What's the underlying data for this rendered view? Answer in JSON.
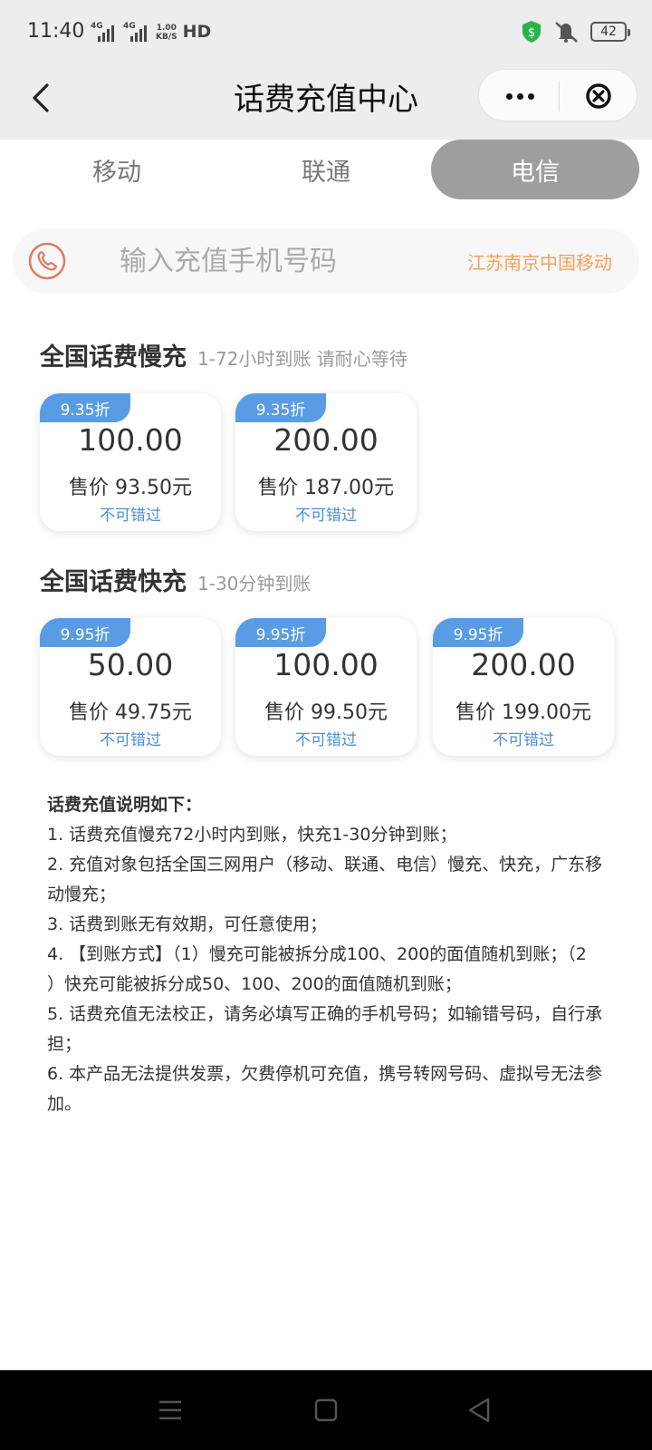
{
  "status_bar": {
    "time": "11:40",
    "signal1_label": "4G",
    "signal2_label": "4G",
    "speed_value": "1.00",
    "speed_unit": "KB/S",
    "hd_label": "HD",
    "battery": "42",
    "icons": [
      "shield-dollar-icon",
      "bell-muted-icon",
      "battery-icon"
    ]
  },
  "nav": {
    "title": "话费充值中心",
    "icons": [
      "back-arrow-icon",
      "more-dots-icon",
      "close-circle-icon"
    ]
  },
  "carrier_tabs": [
    {
      "label": "移动",
      "selected": false
    },
    {
      "label": "联通",
      "selected": false
    },
    {
      "label": "电信",
      "selected": true
    }
  ],
  "phone": {
    "placeholder": "输入充值手机号码",
    "location": "江苏南京中国移动",
    "icon": "phone-icon"
  },
  "slow": {
    "title": "全国话费慢充",
    "subtitle": "1-72小时到账 请耐心等待",
    "cards": [
      {
        "discount": "9.35折",
        "face": "100.00",
        "price": "售价 93.50元",
        "tag": "不可错过"
      },
      {
        "discount": "9.35折",
        "face": "200.00",
        "price": "售价 187.00元",
        "tag": "不可错过"
      }
    ]
  },
  "fast": {
    "title": "全国话费快充",
    "subtitle": "1-30分钟到账",
    "cards": [
      {
        "discount": "9.95折",
        "face": "50.00",
        "price": "售价 49.75元",
        "tag": "不可错过"
      },
      {
        "discount": "9.95折",
        "face": "100.00",
        "price": "售价 99.50元",
        "tag": "不可错过"
      },
      {
        "discount": "9.95折",
        "face": "200.00",
        "price": "售价 199.00元",
        "tag": "不可错过"
      }
    ]
  },
  "notes": {
    "title": "话费充值说明如下：",
    "lines": [
      "1. 话费充值慢充72小时内到账，快充1-30分钟到账；",
      "2. 充值对象包括全国三网用户（移动、联通、电信）慢充、快充，广东移",
      "动慢充；",
      "3. 话费到账无有效期，可任意使用；",
      "4. 【到账方式】（1）慢充可能被拆分成100、200的面值随机到账；（2",
      "）快充可能被拆分成50、100、200的面值随机到账；",
      "5. 话费充值无法校正，请务必填写正确的手机号码；如输错号码，自行承",
      "担；",
      "6. 本产品无法提供发票，欠费停机可充值，携号转网号码、虚拟号无法参",
      "加。"
    ]
  },
  "system_nav": {
    "icons": [
      "menu-icon",
      "home-square-icon",
      "back-triangle-icon"
    ]
  },
  "colors": {
    "badge": "#5a9ce3",
    "tag": "#4a8fd6",
    "location": "#f2a256",
    "phone_icon": "#e07a5f",
    "tab_selected": "#9e9e9e",
    "header_bg": "#ededed"
  }
}
